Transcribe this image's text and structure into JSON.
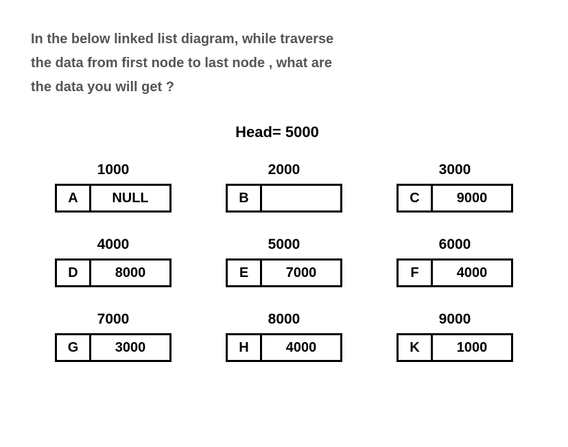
{
  "question": {
    "line1": "In the below linked list diagram, while traverse",
    "line2": "the data from first node to last node , what are",
    "line3": "the data you will get ?"
  },
  "head_label": "Head= 5000",
  "nodes": [
    [
      {
        "address": "1000",
        "data": "A",
        "next": "NULL"
      },
      {
        "address": "2000",
        "data": "B",
        "next": ""
      },
      {
        "address": "3000",
        "data": "C",
        "next": "9000"
      }
    ],
    [
      {
        "address": "4000",
        "data": "D",
        "next": "8000"
      },
      {
        "address": "5000",
        "data": "E",
        "next": "7000"
      },
      {
        "address": "6000",
        "data": "F",
        "next": "4000"
      }
    ],
    [
      {
        "address": "7000",
        "data": "G",
        "next": "3000"
      },
      {
        "address": "8000",
        "data": "H",
        "next": "4000"
      },
      {
        "address": "9000",
        "data": "K",
        "next": "1000"
      }
    ]
  ],
  "chart_data": {
    "type": "diagram",
    "subtype": "linked-list",
    "head": "5000",
    "memory": [
      {
        "address": "1000",
        "data": "A",
        "next": "NULL"
      },
      {
        "address": "2000",
        "data": "B",
        "next": ""
      },
      {
        "address": "3000",
        "data": "C",
        "next": "9000"
      },
      {
        "address": "4000",
        "data": "D",
        "next": "8000"
      },
      {
        "address": "5000",
        "data": "E",
        "next": "7000"
      },
      {
        "address": "6000",
        "data": "F",
        "next": "4000"
      },
      {
        "address": "7000",
        "data": "G",
        "next": "3000"
      },
      {
        "address": "8000",
        "data": "H",
        "next": "4000"
      },
      {
        "address": "9000",
        "data": "K",
        "next": "1000"
      }
    ]
  }
}
